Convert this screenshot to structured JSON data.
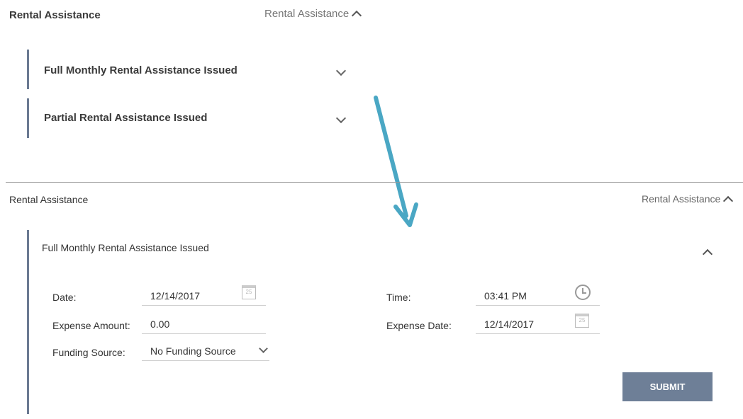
{
  "top": {
    "title": "Rental Assistance",
    "toggle_label": "Rental Assistance",
    "items": [
      {
        "label": "Full Monthly Rental Assistance Issued"
      },
      {
        "label": "Partial Rental Assistance Issued"
      }
    ]
  },
  "bottom": {
    "title": "Rental Assistance",
    "toggle_label": "Rental Assistance",
    "panel": {
      "title": "Full Monthly Rental Assistance Issued",
      "date_label": "Date:",
      "date_value": "12/14/2017",
      "time_label": "Time:",
      "time_value": "03:41 PM",
      "expense_amount_label": "Expense Amount:",
      "expense_amount_value": "0.00",
      "expense_date_label": "Expense Date:",
      "expense_date_value": "12/14/2017",
      "funding_source_label": "Funding Source:",
      "funding_source_value": "No Funding Source",
      "submit_label": "SUBMIT",
      "calendar_day": "25"
    }
  },
  "colors": {
    "accent_bar": "#6b7a92",
    "submit_bg": "#6e7f97",
    "arrow": "#4aa7c4"
  }
}
